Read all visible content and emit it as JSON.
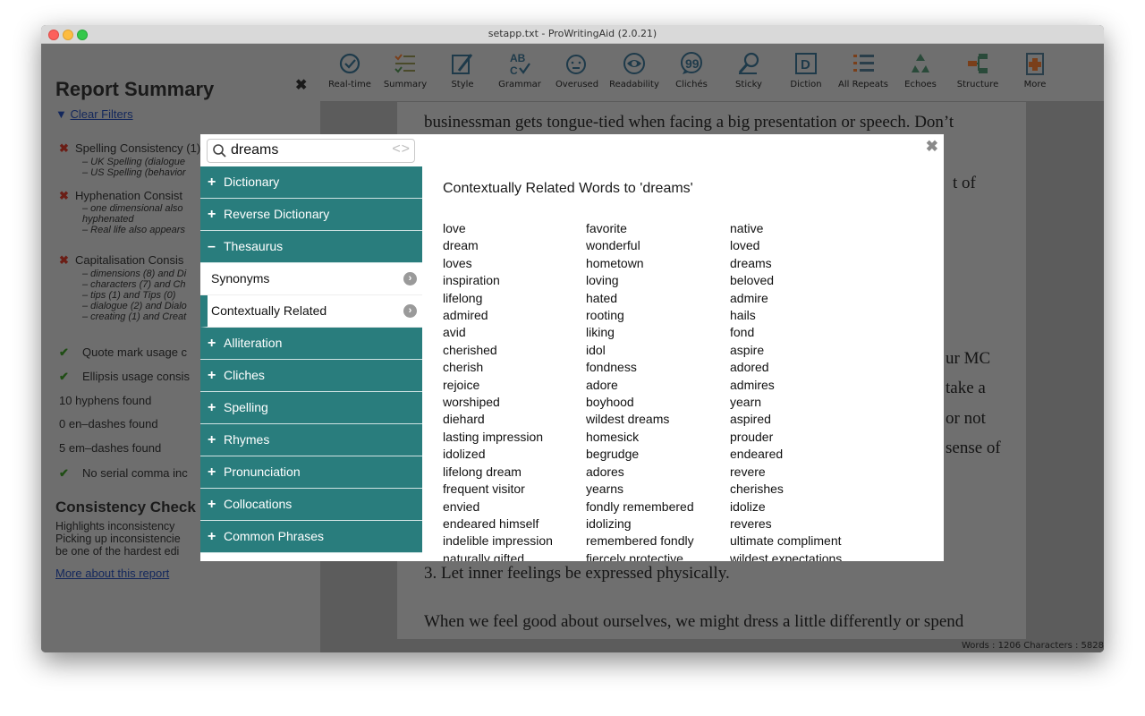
{
  "window": {
    "title": "setapp.txt - ProWritingAid (2.0.21)"
  },
  "report": {
    "title": "Report Summary",
    "clear_filters": "Clear Filters",
    "issues": [
      {
        "text": "Spelling Consistency (1) ▴",
        "subs": [
          "– UK Spelling (dialogue",
          "– US Spelling (behavior"
        ]
      },
      {
        "text": "Hyphenation Consist",
        "subs": [
          "– one dimensional also",
          "hyphenated",
          "– Real life also appears"
        ]
      },
      {
        "text": "Capitalisation Consis",
        "subs": [
          "– dimensions (8) and Di",
          "– characters (7) and Ch",
          "– tips (1) and Tips (0)",
          "– dialogue (2) and Dialo",
          "– creating (1) and Creat"
        ]
      }
    ],
    "checks": [
      "Quote mark usage c",
      "Ellipsis usage consis"
    ],
    "counts": [
      "10 hyphens found",
      "0 en–dashes found",
      "5 em–dashes found"
    ],
    "serial_comma": "No serial comma inc",
    "consistency_title": "Consistency Check",
    "consistency_lines": [
      "Highlights inconsistency",
      "Picking up inconsistencie",
      "be one of the hardest edi"
    ],
    "more_link": "More about this report"
  },
  "toolbar": {
    "items": [
      "Real-time",
      "Summary",
      "Style",
      "Grammar",
      "Overused",
      "Readability",
      "Clichés",
      "Sticky",
      "Diction",
      "All Repeats",
      "Echoes",
      "Structure",
      "More"
    ]
  },
  "document": {
    "line1": "businessman gets tongue-tied when facing a big presentation or speech. Don’t",
    "frag_of": "t of",
    "frag_mc": "ur MC",
    "frag_take": "take a",
    "frag_not": "or not",
    "frag_sense": "sense of",
    "line_heading": "3. Let inner feelings be expressed physically.",
    "line_last": "When we feel good about ourselves, we might dress a little differently or spend"
  },
  "status": "Words : 1206 Characters : 5828",
  "dictionary": {
    "search_value": "dreams",
    "menu": {
      "dictionary": "Dictionary",
      "reverse": "Reverse Dictionary",
      "thesaurus": "Thesaurus",
      "synonyms": "Synonyms",
      "contextual": "Contextually Related",
      "alliteration": "Alliteration",
      "cliches": "Cliches",
      "spelling": "Spelling",
      "rhymes": "Rhymes",
      "pronunciation": "Pronunciation",
      "collocations": "Collocations",
      "common_phrases": "Common Phrases"
    },
    "results_title": "Contextually Related Words to 'dreams'",
    "columns": [
      [
        "love",
        "dream",
        "loves",
        "inspiration",
        "lifelong",
        "admired",
        "avid",
        "cherished",
        "cherish",
        "rejoice",
        "worshiped",
        "diehard",
        "lasting impression",
        "idolized",
        "lifelong dream",
        "frequent visitor",
        "envied",
        "endeared himself",
        "indelible impression",
        "naturally gifted"
      ],
      [
        "favorite",
        "wonderful",
        "hometown",
        "loving",
        "hated",
        "rooting",
        "liking",
        "idol",
        "fondness",
        "adore",
        "boyhood",
        "wildest dreams",
        "homesick",
        "begrudge",
        "adores",
        "yearns",
        "fondly remembered",
        "idolizing",
        "remembered fondly",
        "fiercely protective"
      ],
      [
        "native",
        "loved",
        "dreams",
        "beloved",
        "admire",
        "hails",
        "fond",
        "aspire",
        "adored",
        "admires",
        "yearn",
        "aspired",
        "prouder",
        "endeared",
        "revere",
        "cherishes",
        "idolize",
        "reveres",
        "ultimate compliment",
        "wildest expectations"
      ]
    ]
  }
}
